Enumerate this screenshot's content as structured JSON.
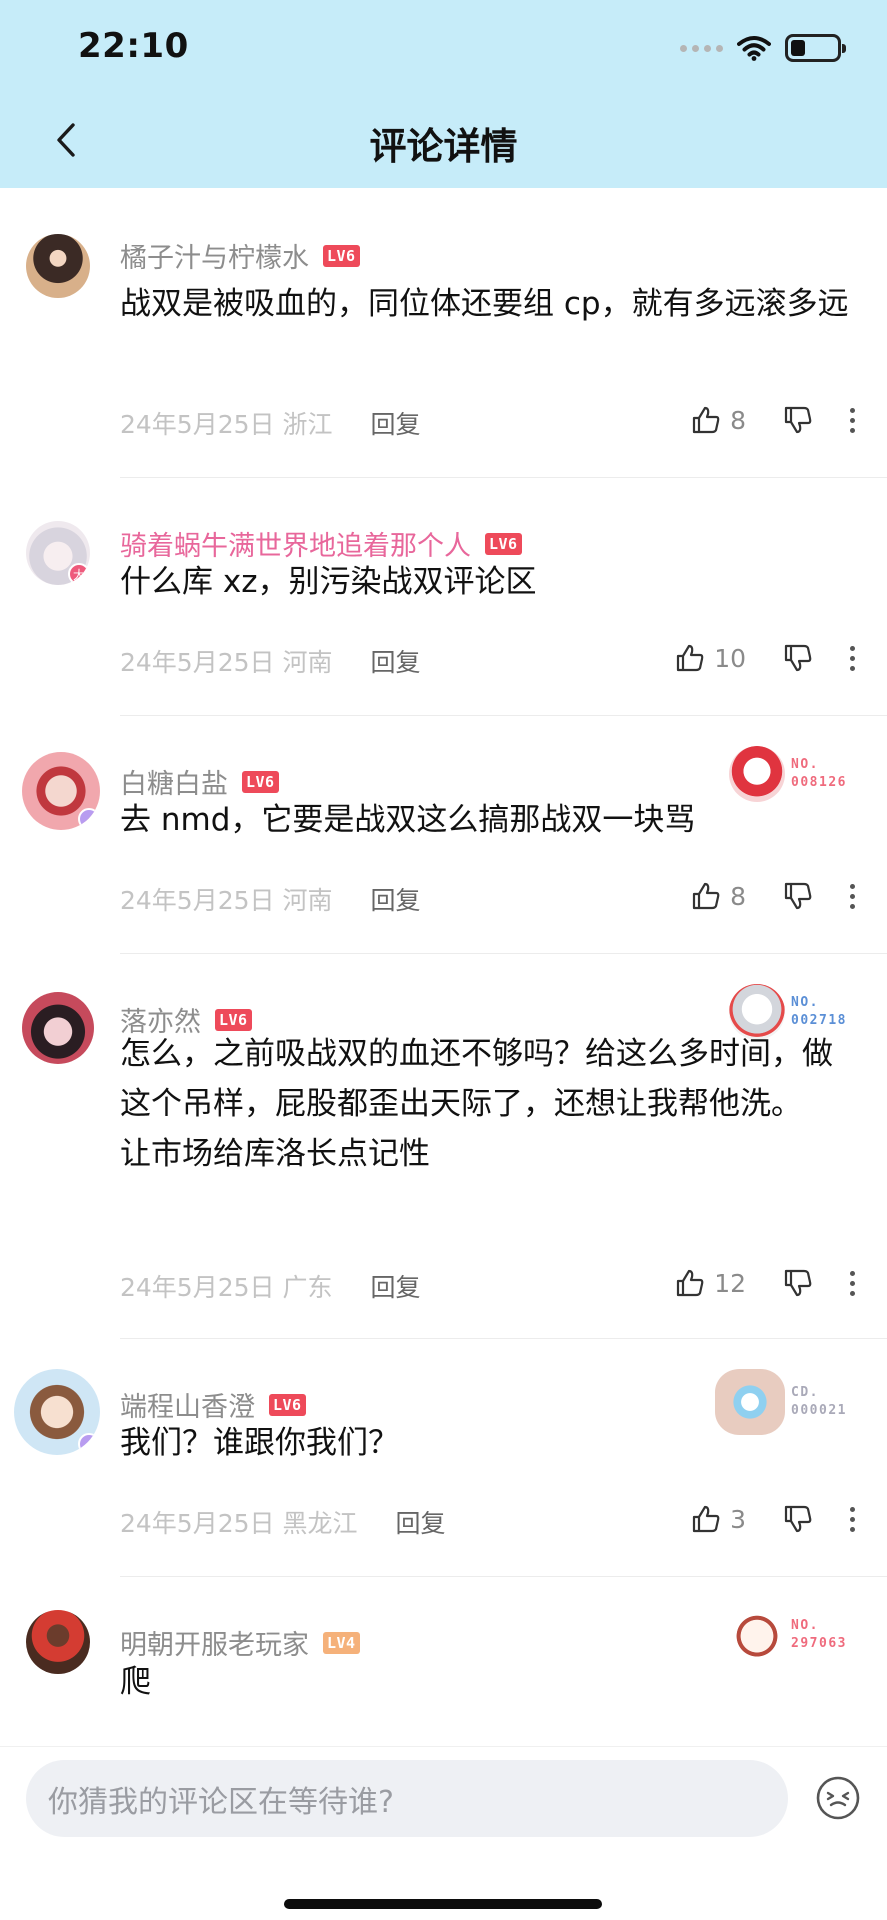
{
  "status": {
    "time": "22:10"
  },
  "header": {
    "title": "评论详情"
  },
  "comments": [
    {
      "user": "橘子汁与柠檬水",
      "level": "LV6",
      "text": [
        "战双是被吸血的，同位体还要组 cp，就有多远滚多远"
      ],
      "date": "24年5月25日",
      "region": "浙江",
      "reply": "回复",
      "likes": "8"
    },
    {
      "user": "骑着蜗牛满世界地追着那个人",
      "level": "LV6",
      "text": [
        "什么库 xz，别污染战双评论区"
      ],
      "date": "24年5月25日",
      "region": "河南",
      "reply": "回复",
      "likes": "10",
      "avatar_badge": "大"
    },
    {
      "user": "白糖白盐",
      "level": "LV6",
      "text": [
        "去 nmd，它要是战双这么搞那战双一块骂"
      ],
      "date": "24年5月25日",
      "region": "河南",
      "reply": "回复",
      "likes": "8",
      "medal": {
        "prefix": "NO.",
        "number": "008126"
      }
    },
    {
      "user": "落亦然",
      "level": "LV6",
      "text": [
        "怎么，之前吸战双的血还不够吗？给这么多时间，做这个吊样，屁股都歪出天际了，还想让我帮他洗。",
        "让市场给库洛长点记性"
      ],
      "date": "24年5月25日",
      "region": "广东",
      "reply": "回复",
      "likes": "12",
      "medal": {
        "prefix": "NO.",
        "number": "002718"
      }
    },
    {
      "user": "端程山香澄",
      "level": "LV6",
      "text": [
        "我们？谁跟你我们？"
      ],
      "date": "24年5月25日",
      "region": "黑龙江",
      "reply": "回复",
      "likes": "3",
      "medal": {
        "prefix": "CD.",
        "number": "000021"
      }
    },
    {
      "user": "明朝开服老玩家",
      "level": "LV4",
      "text": [
        "爬"
      ],
      "medal": {
        "prefix": "NO.",
        "number": "297063"
      }
    }
  ],
  "input": {
    "placeholder": "你猜我的评论区在等待谁?"
  },
  "icons": [
    "back-icon",
    "wifi-icon",
    "battery-icon",
    "thumbs-up-icon",
    "thumbs-down-icon",
    "more-icon",
    "emoji-icon"
  ],
  "colors": {
    "header_bg": "#c6ecf9",
    "level_badge": "#ee4a5a",
    "level4_badge": "#f5b17a",
    "pink_name": "#e8679b"
  }
}
